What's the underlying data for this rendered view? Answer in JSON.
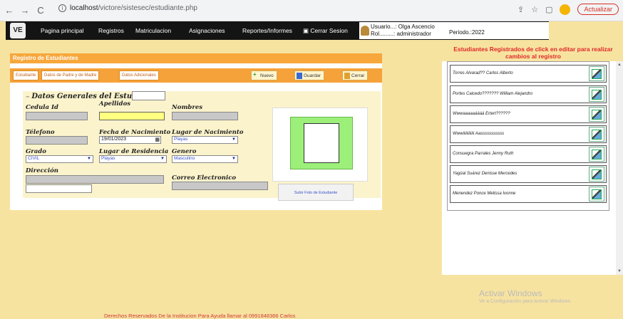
{
  "browser": {
    "url_host": "localhost",
    "url_path": "/victore/sistesec/estudiante.php",
    "update_label": "Actualizar"
  },
  "nav": {
    "logo_text": "VE",
    "items": [
      "Pagina principal",
      "Registros",
      "Matriculacion",
      "Asignaciones",
      "Reportes/Informes",
      "Cerrar Sesion"
    ],
    "user_line": "Usuario...: Olga Ascencio",
    "rol_line": "Rol.........: administrador",
    "periodo": "Periodo.:2022"
  },
  "form": {
    "title": "Registro de Estudiantes",
    "tabs": [
      "Estudiante",
      "Datos de Padre y de Madre",
      "Datos Adicionales"
    ],
    "buttons": {
      "nuevo": "Nuevo",
      "guardar": "Guardar",
      "cerrar": "Cerrar"
    },
    "section_title": "Datos Generales del Estudiante",
    "labels": {
      "cedula": "Cedula Id",
      "apellidos": "Apellidos",
      "nombres": "Nombres",
      "telefono": "Télefono",
      "fecha": "Fecha de Nacimiento",
      "lugar_nac": "Lugar de Nacimiento",
      "grado": "Grado",
      "lugar_res": "Lugar de Residencia",
      "genero": "Genero",
      "direccion": "Dirección",
      "correo": "Correo Electronico"
    },
    "values": {
      "fecha": "19/01/2023",
      "lugar_nac": "Playas",
      "grado": "CIVIL",
      "lugar_res": "Playas",
      "genero": "Masculino"
    },
    "upload_label": "Subir Foto de Estudiante"
  },
  "right": {
    "heading": "Estudiantes Registrados de click en editar para realizar cambios al registro",
    "students": [
      "Torres Alvarad?? Carlos Alberto",
      "Portes Caicedo??????? William Alejandro",
      "Wwwaaaaaáááá Ertert??????",
      "Wwwiiiiiiiiiiii Aasssssssssss",
      "Consuegra Parrales Jenny Ruth",
      "Yagüal Suárez Denisse Mercedes",
      "Menendez Ponce Melissa Ivonne"
    ]
  },
  "watermark": {
    "line1": "Activar Windows",
    "line2": "Ve a Configuración para activar Windows."
  },
  "footer": "Derechos Reservados De la Institucion Para Ayuda llamar al 0991848366 Carlos"
}
